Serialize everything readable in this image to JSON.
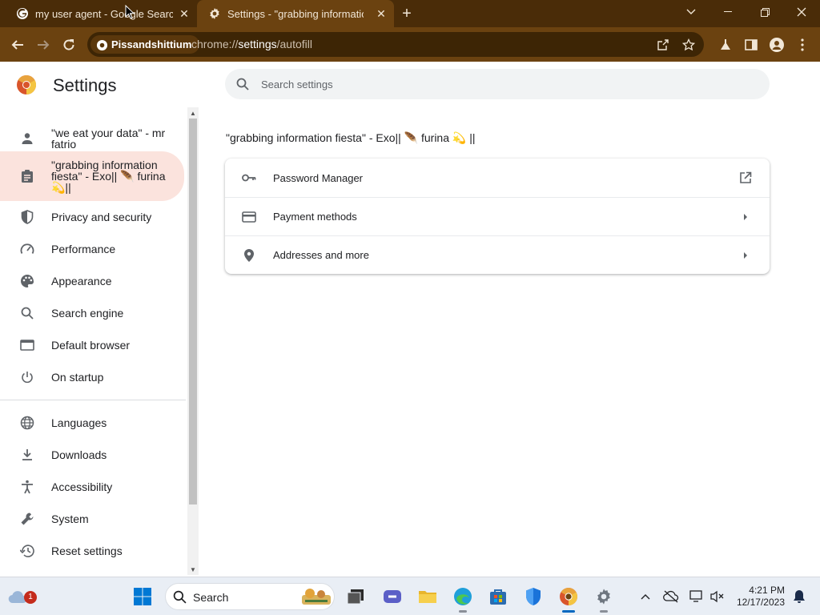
{
  "browser": {
    "tabs": [
      {
        "title": "my user agent - Google Search",
        "icon": "google-icon",
        "active": false
      },
      {
        "title": "Settings - \"grabbing information fiesta\" - Exo|| furina",
        "icon": "gear-icon",
        "active": true
      }
    ],
    "new_tab_label": "+",
    "profile_chip": "Pissandshittium",
    "url_scheme": "chrome://",
    "url_host": "settings",
    "url_path": "/autofill",
    "colors": {
      "frame": "#4a2c08",
      "toolbar": "#6b4210",
      "omnibox": "#3d2505"
    }
  },
  "settings": {
    "title": "Settings",
    "search_placeholder": "Search settings",
    "sidebar": {
      "items": [
        {
          "label": "\"we eat your data\" - mr fatrio",
          "icon": "person-icon",
          "active": false
        },
        {
          "label": "\"grabbing information fiesta\" - Exo|| 🪶 furina 💫||",
          "icon": "clipboard-icon",
          "active": true
        },
        {
          "label": "Privacy and security",
          "icon": "shield-icon",
          "active": false
        },
        {
          "label": "Performance",
          "icon": "speedometer-icon",
          "active": false
        },
        {
          "label": "Appearance",
          "icon": "palette-icon",
          "active": false
        },
        {
          "label": "Search engine",
          "icon": "search-icon",
          "active": false
        },
        {
          "label": "Default browser",
          "icon": "browser-window-icon",
          "active": false
        },
        {
          "label": "On startup",
          "icon": "power-icon",
          "active": false
        },
        {
          "label": "Languages",
          "icon": "globe-icon",
          "active": false
        },
        {
          "label": "Downloads",
          "icon": "download-icon",
          "active": false
        },
        {
          "label": "Accessibility",
          "icon": "accessibility-icon",
          "active": false
        },
        {
          "label": "System",
          "icon": "wrench-icon",
          "active": false
        },
        {
          "label": "Reset settings",
          "icon": "history-icon",
          "active": false
        }
      ]
    },
    "section_title": "\"grabbing information fiesta\" - Exo|| 🪶 furina 💫 ||",
    "autofill_rows": [
      {
        "label": "Password Manager",
        "icon": "key-icon",
        "trailing": "open-external-icon"
      },
      {
        "label": "Payment methods",
        "icon": "credit-card-icon",
        "trailing": "arrow-right-icon"
      },
      {
        "label": "Addresses and more",
        "icon": "location-pin-icon",
        "trailing": "arrow-right-icon"
      }
    ],
    "accent_color": "#fbe3dd"
  },
  "taskbar": {
    "search_label": "Search",
    "time": "4:21 PM",
    "date": "12/17/2023",
    "weather_badge": "1",
    "apps": [
      "start-icon",
      "search-icon",
      "file-explorer-icon",
      "meet-icon",
      "folder-icon",
      "edge-icon",
      "store-icon",
      "defender-icon",
      "chrome-icon",
      "settings-icon"
    ]
  }
}
